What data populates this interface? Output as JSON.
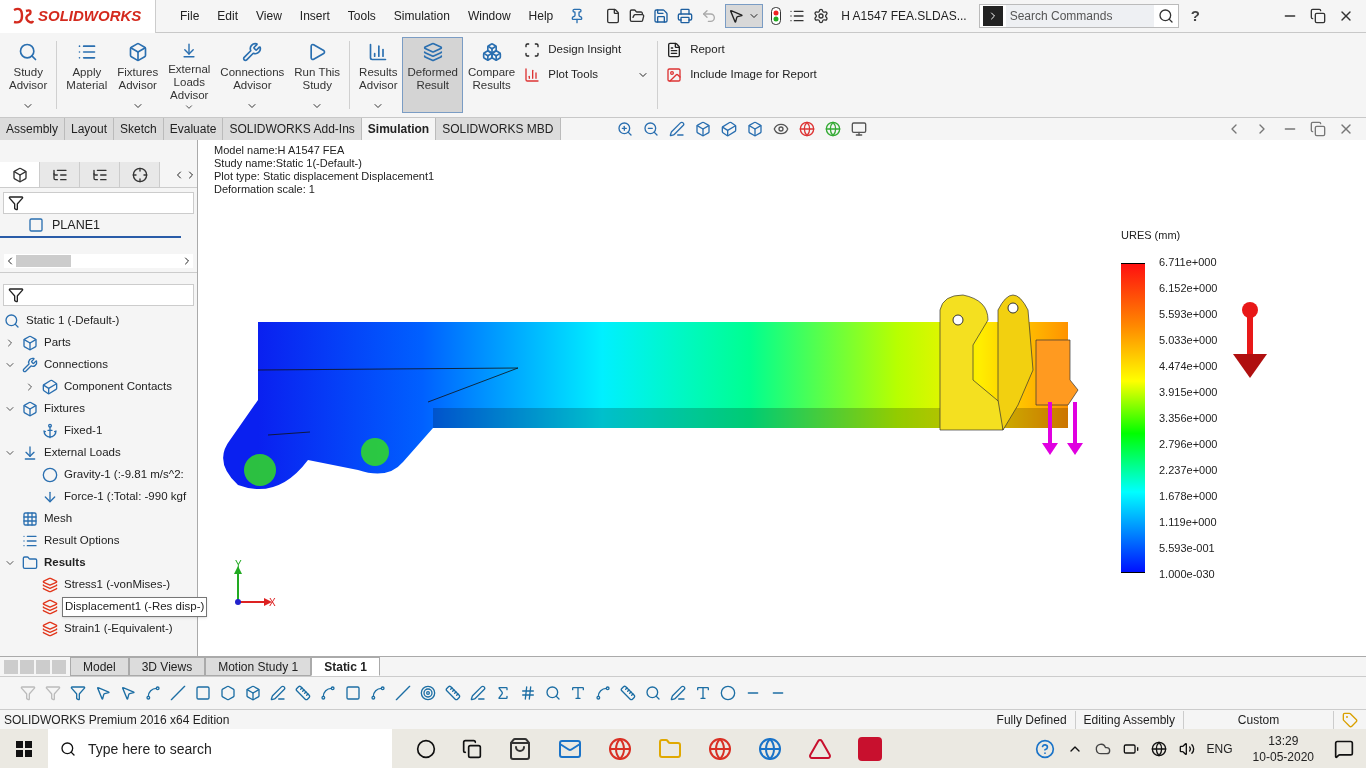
{
  "app": {
    "logo": "SOLIDWORKS"
  },
  "menu": [
    "File",
    "Edit",
    "View",
    "Insert",
    "Tools",
    "Simulation",
    "Window",
    "Help"
  ],
  "document_title": "H A1547 FEA.SLDAS...",
  "search": {
    "placeholder": "Search Commands"
  },
  "help_label": "?",
  "ribbon": {
    "large_buttons": [
      {
        "label": "Study\nAdvisor",
        "dropdown": true,
        "selected": false
      },
      {
        "label": "Apply\nMaterial",
        "dropdown": false,
        "selected": false
      },
      {
        "label": "Fixtures\nAdvisor",
        "dropdown": true,
        "selected": false
      },
      {
        "label": "External\nLoads\nAdvisor",
        "dropdown": true,
        "selected": false
      },
      {
        "label": "Connections\nAdvisor",
        "dropdown": true,
        "selected": false
      },
      {
        "label": "Run This\nStudy",
        "dropdown": true,
        "selected": false
      },
      {
        "label": "Results\nAdvisor",
        "dropdown": true,
        "selected": false
      },
      {
        "label": "Deformed\nResult",
        "dropdown": false,
        "selected": true
      },
      {
        "label": "Compare\nResults",
        "dropdown": false,
        "selected": false
      }
    ],
    "small_buttons": [
      "Design Insight",
      "Plot Tools"
    ],
    "report_buttons": [
      "Report",
      "Include Image for Report"
    ]
  },
  "command_tabs": [
    {
      "label": "Assembly",
      "selected": false
    },
    {
      "label": "Layout",
      "selected": false
    },
    {
      "label": "Sketch",
      "selected": false
    },
    {
      "label": "Evaluate",
      "selected": false
    },
    {
      "label": "SOLIDWORKS Add-Ins",
      "selected": false
    },
    {
      "label": "Simulation",
      "selected": true
    },
    {
      "label": "SOLIDWORKS MBD",
      "selected": false
    }
  ],
  "feature_panel": {
    "plane": "PLANE1",
    "tabs": [
      {
        "selected": true
      },
      {
        "selected": false
      },
      {
        "selected": false
      },
      {
        "selected": false
      }
    ]
  },
  "tree": {
    "label": "Static 1 (-Default-)",
    "kind": "study",
    "selected": false,
    "children": [
      {
        "label": "Parts",
        "kind": "parts",
        "expanded": false,
        "selected": false
      },
      {
        "label": "Connections",
        "kind": "connections",
        "expanded": true,
        "selected": false,
        "children": [
          {
            "label": "Component Contacts",
            "kind": "contacts",
            "expanded": false,
            "selected": false
          }
        ]
      },
      {
        "label": "Fixtures",
        "kind": "fixtures",
        "expanded": true,
        "selected": false,
        "children": [
          {
            "label": "Fixed-1",
            "kind": "fixed",
            "selected": false
          }
        ]
      },
      {
        "label": "External Loads",
        "kind": "loads",
        "expanded": true,
        "selected": false,
        "children": [
          {
            "label": "Gravity-1 (:-9.81 m/s^2:",
            "kind": "gravity",
            "selected": false
          },
          {
            "label": "Force-1 (:Total: -990 kgf",
            "kind": "force",
            "selected": false
          }
        ]
      },
      {
        "label": "Mesh",
        "kind": "mesh",
        "selected": false
      },
      {
        "label": "Result Options",
        "kind": "options",
        "selected": false
      },
      {
        "label": "Results",
        "kind": "results",
        "expanded": true,
        "selected": false,
        "children": [
          {
            "label": "Stress1 (-vonMises-)",
            "kind": "plot",
            "selected": false
          },
          {
            "label": "Displacement1 (-Res disp-)",
            "kind": "plot",
            "selected": true
          },
          {
            "label": "Strain1 (-Equivalent-)",
            "kind": "plot",
            "selected": false
          }
        ]
      }
    ]
  },
  "plot_info": [
    "Model name:H A1547 FEA",
    "Study name:Static 1(-Default-)",
    "Plot type: Static displacement Displacement1",
    "Deformation scale: 1"
  ],
  "legend": {
    "title": "URES (mm)",
    "labels": [
      "6.711e+000",
      "6.152e+000",
      "5.593e+000",
      "5.033e+000",
      "4.474e+000",
      "3.915e+000",
      "3.356e+000",
      "2.796e+000",
      "2.237e+000",
      "1.678e+000",
      "1.119e+000",
      "5.593e-001",
      "1.000e-030"
    ]
  },
  "axes": {
    "x": "X",
    "y": "Y"
  },
  "bottom_tabs": [
    {
      "label": "Model",
      "selected": false
    },
    {
      "label": "3D Views",
      "selected": false
    },
    {
      "label": "Motion Study 1",
      "selected": false
    },
    {
      "label": "Static 1",
      "selected": true
    }
  ],
  "status_bar": {
    "edition": "SOLIDWORKS Premium 2016 x64 Edition",
    "fields": [
      "Fully Defined",
      "Editing Assembly",
      "Custom"
    ]
  },
  "taskbar": {
    "search_placeholder": "Type here to search",
    "language": "ENG",
    "time": "13:29",
    "date": "10-05-2020"
  }
}
